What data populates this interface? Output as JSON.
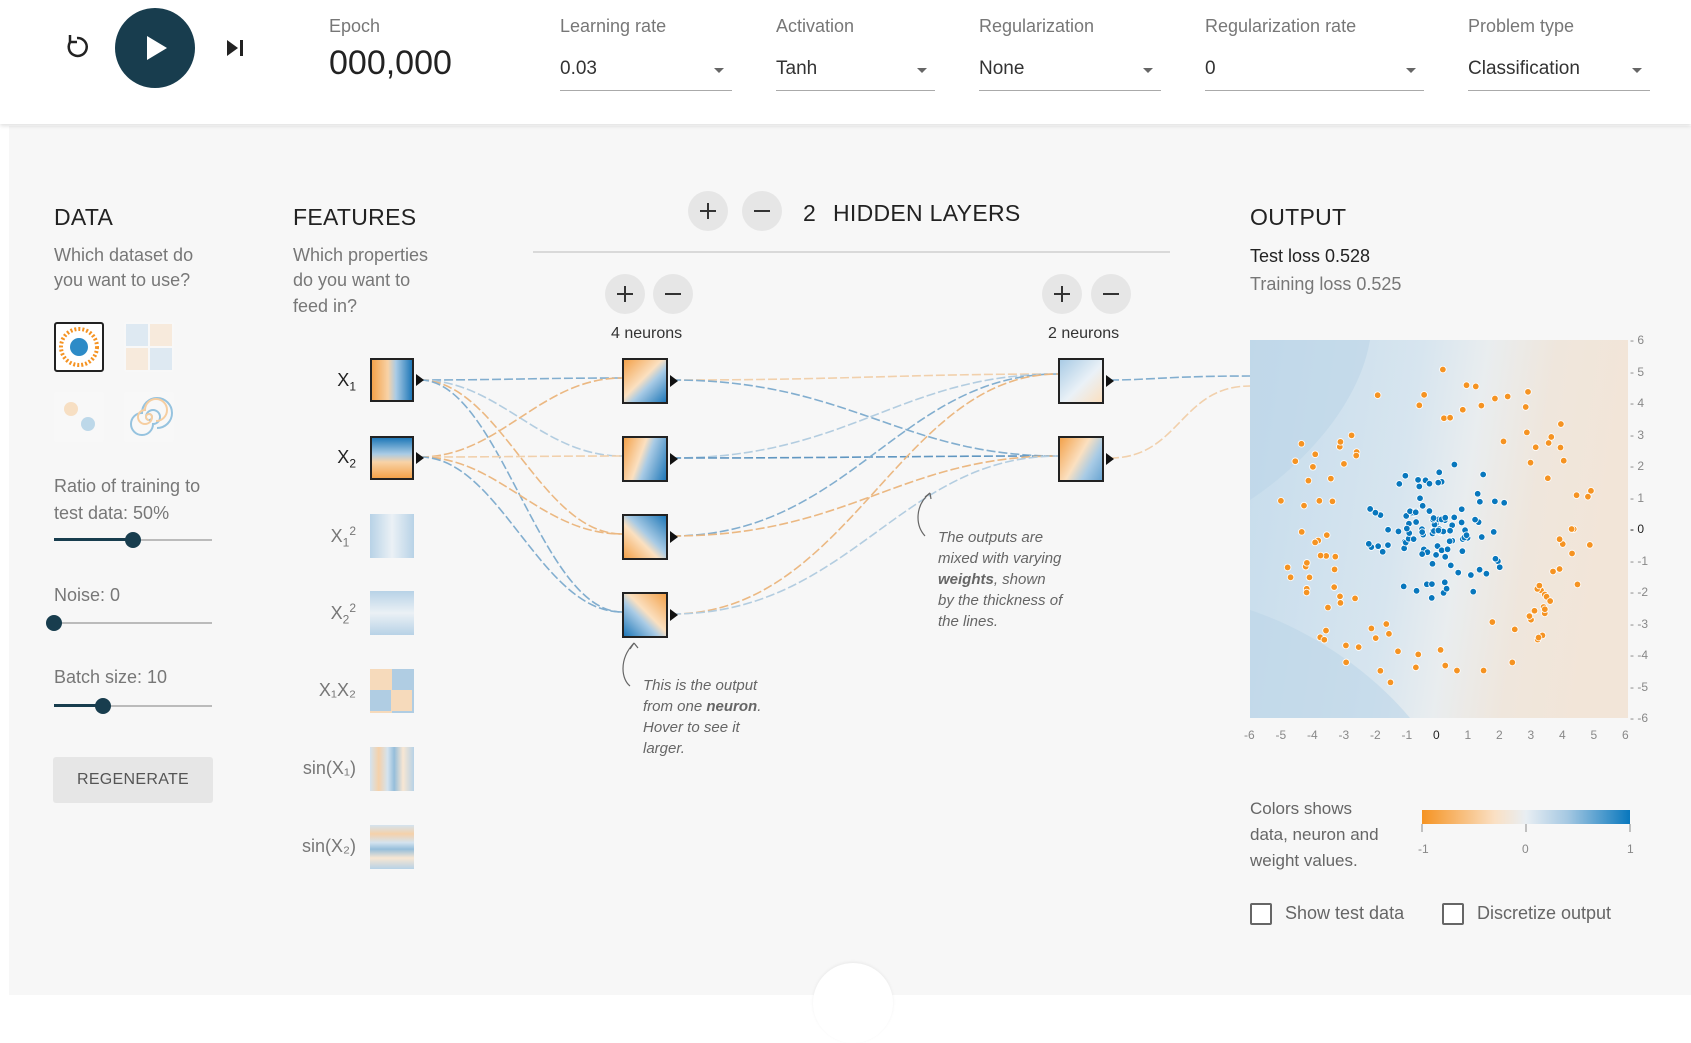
{
  "controls": {
    "reset_icon": "reset-icon",
    "play_icon": "play-icon",
    "step_icon": "step-forward-icon"
  },
  "epoch": {
    "label": "Epoch",
    "value": "000,000"
  },
  "dropdowns": [
    {
      "label": "Learning rate",
      "value": "0.03"
    },
    {
      "label": "Activation",
      "value": "Tanh"
    },
    {
      "label": "Regularization",
      "value": "None"
    },
    {
      "label": "Regularization rate",
      "value": "0"
    },
    {
      "label": "Problem type",
      "value": "Classification"
    }
  ],
  "data": {
    "title": "DATA",
    "question_1": "Which dataset do",
    "question_2": "you want to use?",
    "ratio_label_1": "Ratio of training to",
    "ratio_label_2": "test data:  50%",
    "ratio_percent": 50,
    "noise_label": "Noise:  0",
    "noise_value": 0,
    "batch_label": "Batch size:  10",
    "batch_value": 10,
    "regenerate": "REGENERATE"
  },
  "features": {
    "title": "FEATURES",
    "question_1": "Which properties",
    "question_2": "do you want to",
    "question_3": "feed in?",
    "items": [
      {
        "label": "X",
        "sub": "1",
        "active": true
      },
      {
        "label": "X",
        "sub": "2",
        "active": true
      },
      {
        "label": "X",
        "sub": "1",
        "sup": "2",
        "active": false
      },
      {
        "label": "X",
        "sub": "2",
        "sup": "2",
        "active": false
      },
      {
        "label": "X₁X₂",
        "active": false
      },
      {
        "label": "sin(X₁)",
        "active": false
      },
      {
        "label": "sin(X₂)",
        "active": false
      }
    ]
  },
  "hidden": {
    "count": "2",
    "title": "HIDDEN LAYERS",
    "layer1_label": "4 neurons",
    "layer2_label": "2 neurons",
    "note_neuron_1": "This is the output",
    "note_neuron_2a": "from one ",
    "note_neuron_2b": "neuron",
    "note_neuron_2c": ".",
    "note_neuron_3": "Hover to see it",
    "note_neuron_4": "larger.",
    "note_weights_1": "The outputs are",
    "note_weights_2": "mixed with varying",
    "note_weights_3a": "weights",
    "note_weights_3b": ", shown",
    "note_weights_4": "by the thickness of",
    "note_weights_5": "the lines."
  },
  "output": {
    "title": "OUTPUT",
    "test_loss": "Test loss 0.528",
    "training_loss": "Training loss 0.525",
    "x_ticks": [
      "-6",
      "-5",
      "-4",
      "-3",
      "-2",
      "-1",
      "0",
      "1",
      "2",
      "3",
      "4",
      "5",
      "6"
    ],
    "y_ticks": [
      "6",
      "5",
      "4",
      "3",
      "2",
      "1",
      "0",
      "-1",
      "-2",
      "-3",
      "-4",
      "-5",
      "-6"
    ],
    "legend_1": "Colors shows",
    "legend_2": "data, neuron and",
    "legend_3": "weight values.",
    "scale_ticks": [
      "-1",
      "0",
      "1"
    ],
    "show_test": "Show test data",
    "discretize": "Discretize output"
  },
  "colors": {
    "orange": "#f59322",
    "blue": "#0877bd",
    "dark": "#183d4e"
  }
}
